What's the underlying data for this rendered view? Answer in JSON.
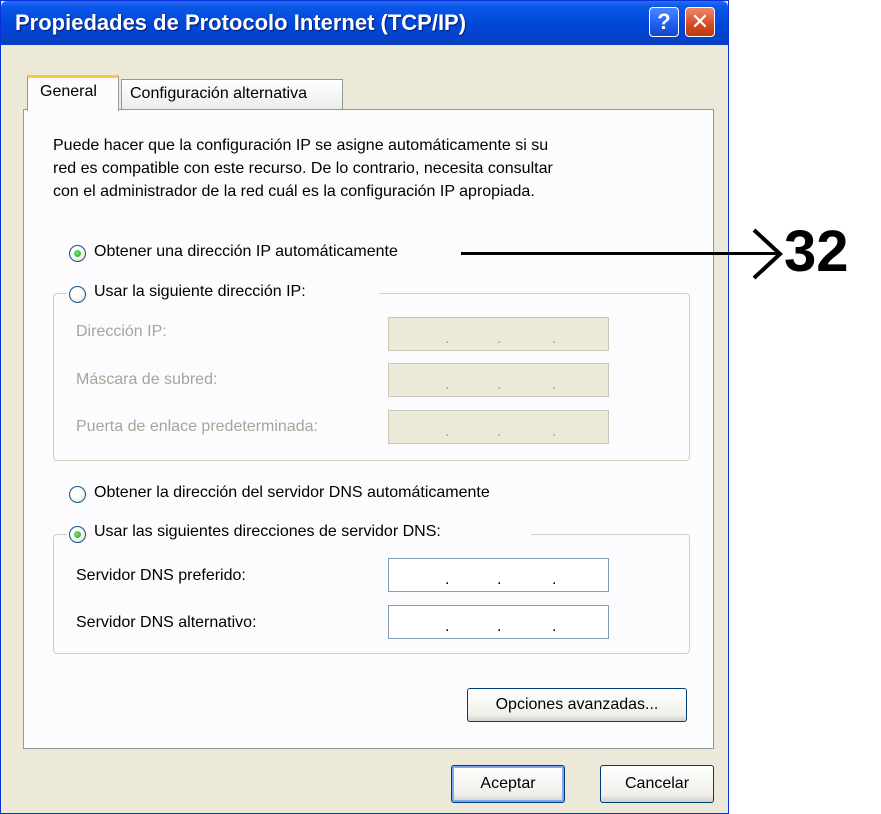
{
  "window": {
    "title": "Propiedades de Protocolo Internet (TCP/IP)",
    "help_icon": "question-mark-icon",
    "close_icon": "x-close-icon"
  },
  "tabs": [
    {
      "label": "General",
      "selected": true
    },
    {
      "label": "Configuración alternativa",
      "selected": false
    }
  ],
  "description": [
    "Puede hacer que la configuración IP se asigne automáticamente si su",
    "red es compatible con este recurso. De lo contrario, necesita consultar",
    "con el administrador de la red cuál es la configuración IP apropiada."
  ],
  "ip_options": {
    "auto_label": "Obtener una dirección IP automáticamente",
    "auto_selected": true,
    "manual_label": "Usar la siguiente dirección IP:",
    "manual_selected": false,
    "fields": [
      {
        "label": "Dirección IP:",
        "value": ". . ."
      },
      {
        "label": "Máscara de subred:",
        "value": ". . ."
      },
      {
        "label": "Puerta de enlace predeterminada:",
        "value": ". . ."
      }
    ]
  },
  "dns_options": {
    "auto_label": "Obtener la dirección del servidor DNS automáticamente",
    "auto_selected": false,
    "manual_label": "Usar las siguientes direcciones de servidor DNS:",
    "manual_selected": true,
    "fields": [
      {
        "label": "Servidor DNS preferido:",
        "value": ". . ."
      },
      {
        "label": "Servidor DNS alternativo:",
        "value": ". . ."
      }
    ]
  },
  "buttons": {
    "advanced": "Opciones avanzadas...",
    "ok": "Aceptar",
    "cancel": "Cancelar"
  },
  "annotation": {
    "number": "32"
  }
}
